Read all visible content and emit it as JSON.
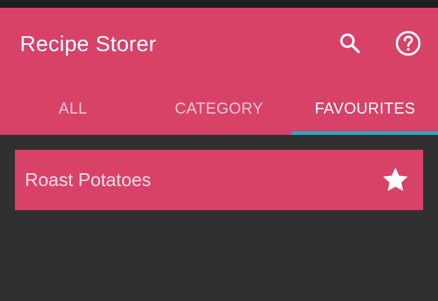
{
  "app_bar": {
    "title": "Recipe Storer",
    "background_color": "#d84268",
    "actions": [
      {
        "name": "search",
        "icon": "search-icon"
      },
      {
        "name": "help",
        "icon": "help-circle-icon"
      }
    ]
  },
  "tabs": [
    {
      "label": "ALL",
      "active": false
    },
    {
      "label": "CATEGORY",
      "active": false
    },
    {
      "label": "FAVOURITES",
      "active": true
    }
  ],
  "tab_indicator_color": "#2aa9bd",
  "recipes": [
    {
      "title": "Roast Potatoes",
      "favourite": true,
      "icon": "star-icon"
    }
  ],
  "colors": {
    "background": "#303030",
    "accent": "#d84268",
    "indicator": "#2aa9bd"
  }
}
